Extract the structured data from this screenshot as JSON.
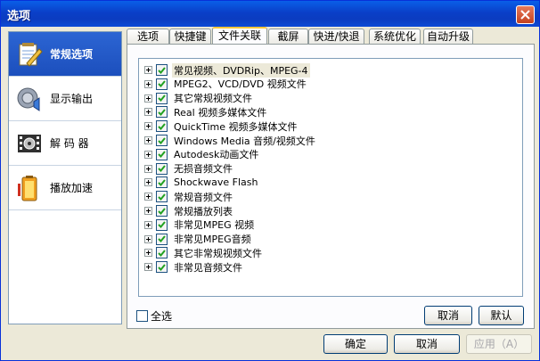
{
  "window": {
    "title": "选项"
  },
  "sidebar": {
    "items": [
      {
        "label": "常规选项",
        "icon": "notepad-pencil-icon",
        "selected": true
      },
      {
        "label": "显示输出",
        "icon": "display-speaker-icon",
        "selected": false
      },
      {
        "label": "解 码 器",
        "icon": "film-gear-icon",
        "selected": false
      },
      {
        "label": "播放加速",
        "icon": "battery-icon",
        "selected": false
      }
    ]
  },
  "tabs": [
    {
      "label": "选项",
      "selected": false
    },
    {
      "label": "快捷键",
      "selected": false
    },
    {
      "label": "文件关联",
      "selected": true
    },
    {
      "label": "截屏",
      "selected": false
    },
    {
      "label": "快进/快退",
      "selected": false
    },
    {
      "label": "系统优化",
      "selected": false
    },
    {
      "label": "自动升级",
      "selected": false
    }
  ],
  "file_types": [
    {
      "label": "常见视频、DVDRip、MPEG-4",
      "checked": true
    },
    {
      "label": "MPEG2、VCD/DVD 视频文件",
      "checked": true
    },
    {
      "label": "其它常规视频文件",
      "checked": true
    },
    {
      "label": "Real 视频多媒体文件",
      "checked": true
    },
    {
      "label": "QuickTime 视频多媒体文件",
      "checked": true
    },
    {
      "label": "Windows Media 音频/视频文件",
      "checked": true
    },
    {
      "label": "Autodesk动画文件",
      "checked": true
    },
    {
      "label": "无损音频文件",
      "checked": true
    },
    {
      "label": "Shockwave Flash",
      "checked": true
    },
    {
      "label": "常规音频文件",
      "checked": true
    },
    {
      "label": "常规播放列表",
      "checked": true
    },
    {
      "label": "非常见MPEG 视频",
      "checked": true
    },
    {
      "label": "非常见MPEG音频",
      "checked": true
    },
    {
      "label": "其它非常规视频文件",
      "checked": true
    },
    {
      "label": "非常见音频文件",
      "checked": true
    }
  ],
  "panel": {
    "select_all_label": "全选",
    "select_all_checked": false,
    "cancel_label": "取消",
    "default_label": "默认"
  },
  "footer": {
    "ok_label": "确定",
    "cancel_label": "取消",
    "apply_label": "应用（A）"
  },
  "colors": {
    "titlebar": "#0a4fd8",
    "selected_nav": "#2c65d3",
    "check_green": "#21a121"
  }
}
